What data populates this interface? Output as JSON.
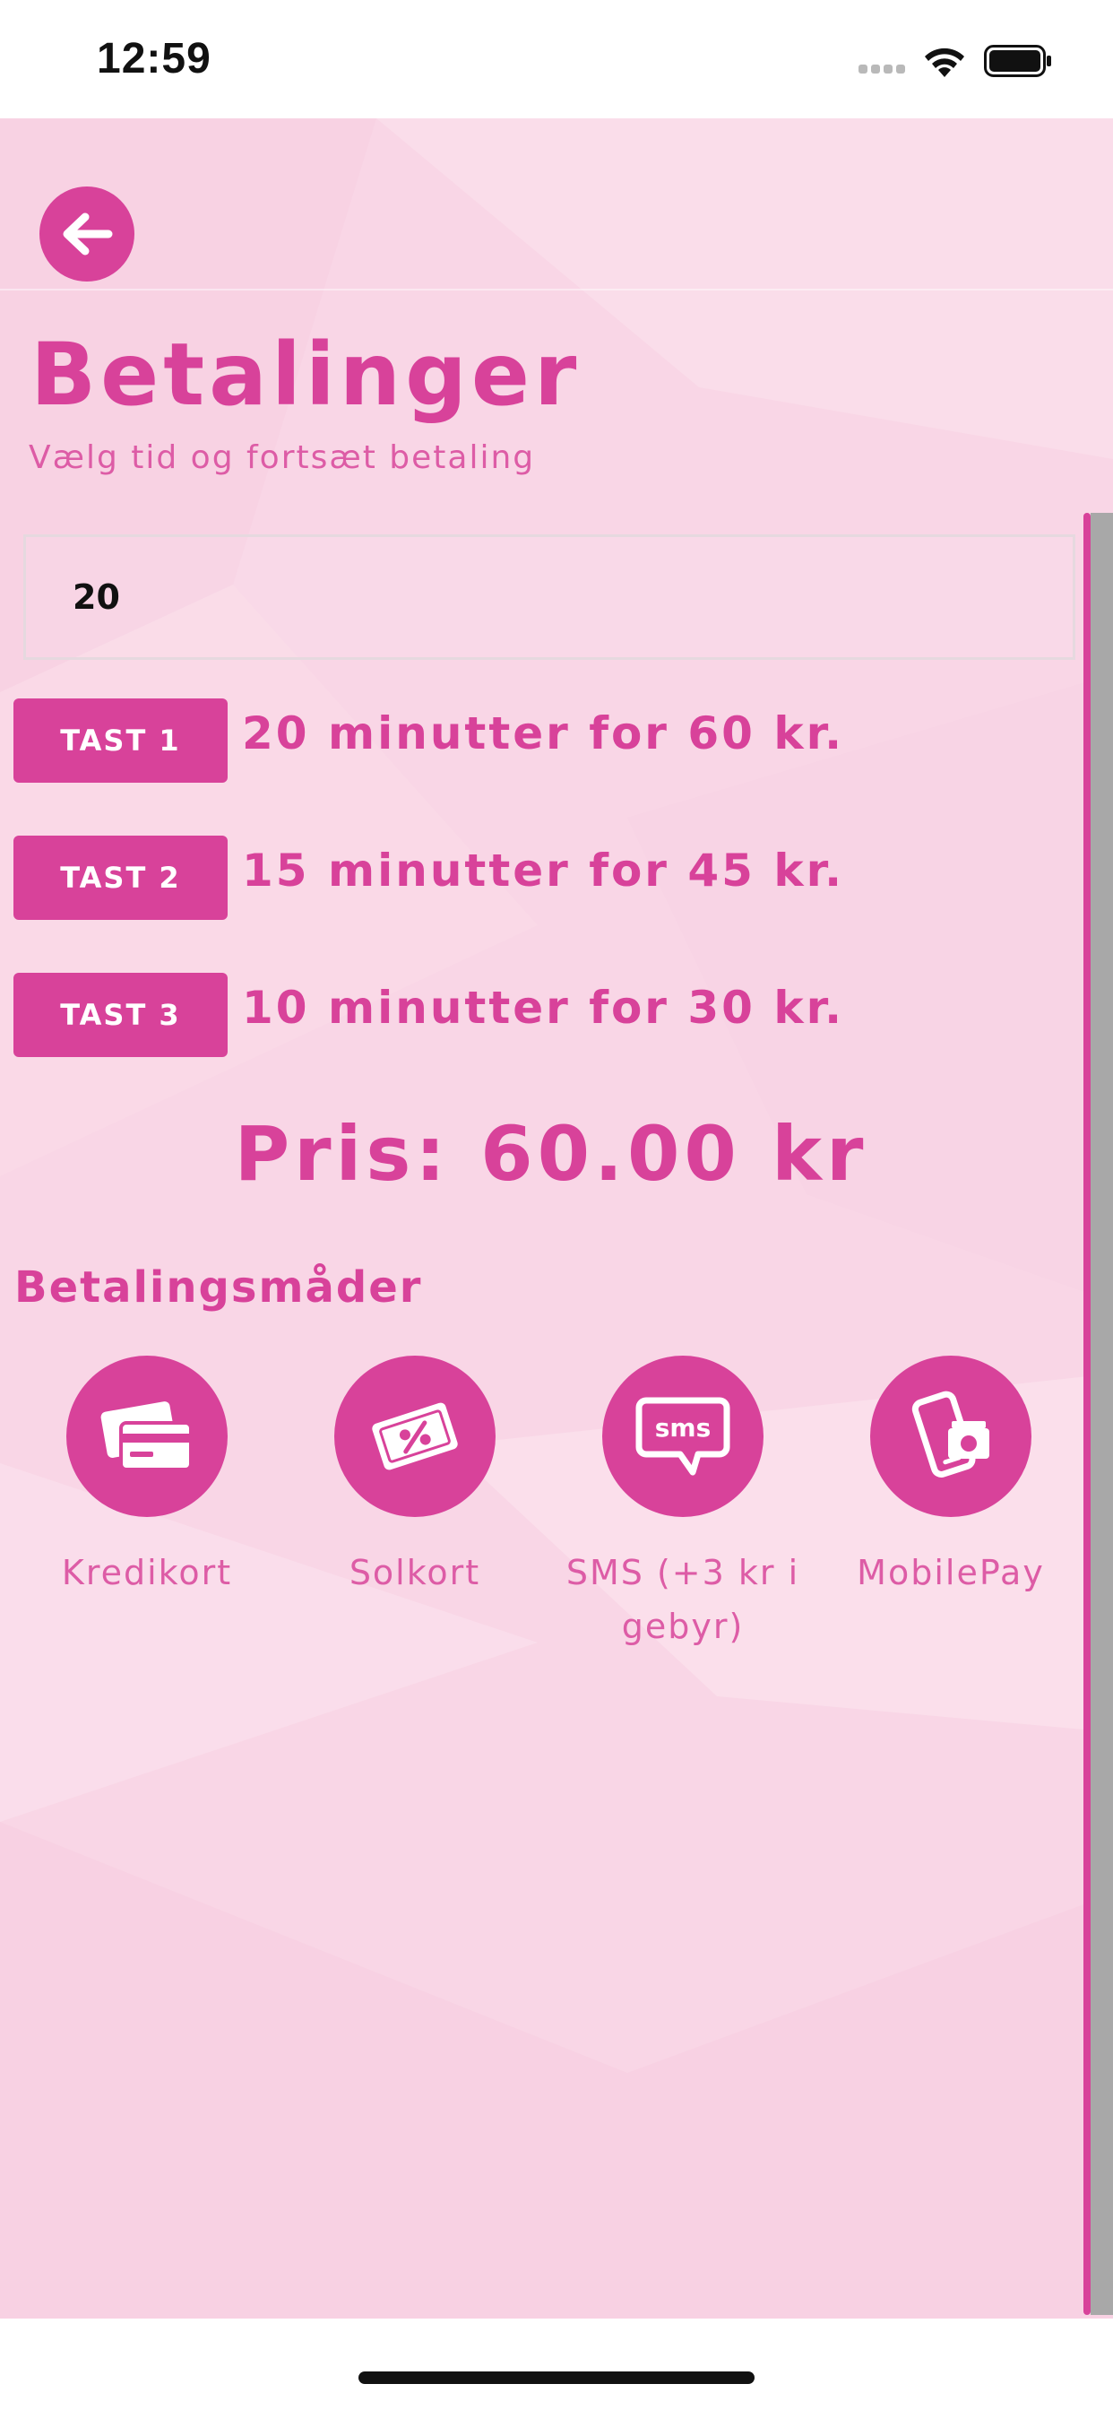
{
  "status_bar": {
    "time": "12:59"
  },
  "header": {
    "back_icon": "arrow-left-icon",
    "title": "Betalinger",
    "subtitle": "Vælg tid og fortsæt betaling"
  },
  "time_input": {
    "value": "20"
  },
  "options": [
    {
      "button": "TAST 1",
      "text": "20 minutter for 60 kr."
    },
    {
      "button": "TAST 2",
      "text": "15 minutter for 45 kr."
    },
    {
      "button": "TAST 3",
      "text": "10 minutter for 30 kr."
    }
  ],
  "price": "Pris: 60.00 kr",
  "payment": {
    "heading": "Betalingsmåder",
    "methods": [
      {
        "label": "Kredikort",
        "icon": "credit-card-icon"
      },
      {
        "label": "Solkort",
        "icon": "gift-card-icon"
      },
      {
        "label": "SMS (+3 kr i gebyr)",
        "icon": "sms-icon"
      },
      {
        "label": "MobilePay",
        "icon": "mobilepay-icon"
      }
    ]
  },
  "colors": {
    "accent": "#d8429a",
    "background": "#f9d6e6",
    "text_light": "#dd5ca6"
  }
}
